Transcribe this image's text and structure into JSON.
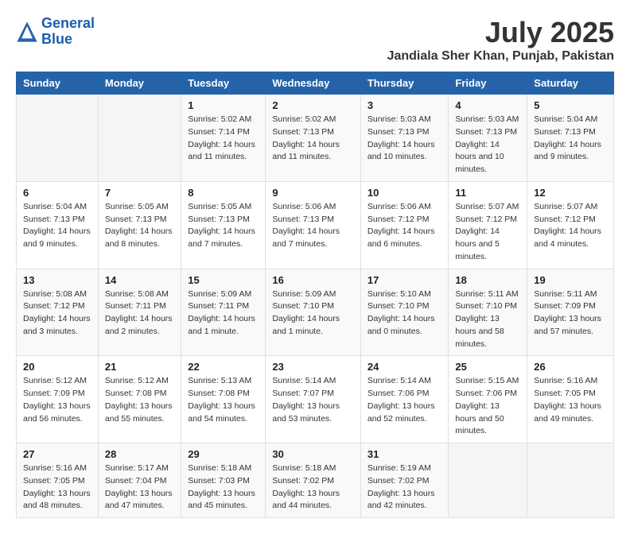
{
  "header": {
    "logo_line1": "General",
    "logo_line2": "Blue",
    "month": "July 2025",
    "location": "Jandiala Sher Khan, Punjab, Pakistan"
  },
  "days_of_week": [
    "Sunday",
    "Monday",
    "Tuesday",
    "Wednesday",
    "Thursday",
    "Friday",
    "Saturday"
  ],
  "weeks": [
    [
      {
        "day": "",
        "info": ""
      },
      {
        "day": "",
        "info": ""
      },
      {
        "day": "1",
        "info": "Sunrise: 5:02 AM\nSunset: 7:14 PM\nDaylight: 14 hours and 11 minutes."
      },
      {
        "day": "2",
        "info": "Sunrise: 5:02 AM\nSunset: 7:13 PM\nDaylight: 14 hours and 11 minutes."
      },
      {
        "day": "3",
        "info": "Sunrise: 5:03 AM\nSunset: 7:13 PM\nDaylight: 14 hours and 10 minutes."
      },
      {
        "day": "4",
        "info": "Sunrise: 5:03 AM\nSunset: 7:13 PM\nDaylight: 14 hours and 10 minutes."
      },
      {
        "day": "5",
        "info": "Sunrise: 5:04 AM\nSunset: 7:13 PM\nDaylight: 14 hours and 9 minutes."
      }
    ],
    [
      {
        "day": "6",
        "info": "Sunrise: 5:04 AM\nSunset: 7:13 PM\nDaylight: 14 hours and 9 minutes."
      },
      {
        "day": "7",
        "info": "Sunrise: 5:05 AM\nSunset: 7:13 PM\nDaylight: 14 hours and 8 minutes."
      },
      {
        "day": "8",
        "info": "Sunrise: 5:05 AM\nSunset: 7:13 PM\nDaylight: 14 hours and 7 minutes."
      },
      {
        "day": "9",
        "info": "Sunrise: 5:06 AM\nSunset: 7:13 PM\nDaylight: 14 hours and 7 minutes."
      },
      {
        "day": "10",
        "info": "Sunrise: 5:06 AM\nSunset: 7:12 PM\nDaylight: 14 hours and 6 minutes."
      },
      {
        "day": "11",
        "info": "Sunrise: 5:07 AM\nSunset: 7:12 PM\nDaylight: 14 hours and 5 minutes."
      },
      {
        "day": "12",
        "info": "Sunrise: 5:07 AM\nSunset: 7:12 PM\nDaylight: 14 hours and 4 minutes."
      }
    ],
    [
      {
        "day": "13",
        "info": "Sunrise: 5:08 AM\nSunset: 7:12 PM\nDaylight: 14 hours and 3 minutes."
      },
      {
        "day": "14",
        "info": "Sunrise: 5:08 AM\nSunset: 7:11 PM\nDaylight: 14 hours and 2 minutes."
      },
      {
        "day": "15",
        "info": "Sunrise: 5:09 AM\nSunset: 7:11 PM\nDaylight: 14 hours and 1 minute."
      },
      {
        "day": "16",
        "info": "Sunrise: 5:09 AM\nSunset: 7:10 PM\nDaylight: 14 hours and 1 minute."
      },
      {
        "day": "17",
        "info": "Sunrise: 5:10 AM\nSunset: 7:10 PM\nDaylight: 14 hours and 0 minutes."
      },
      {
        "day": "18",
        "info": "Sunrise: 5:11 AM\nSunset: 7:10 PM\nDaylight: 13 hours and 58 minutes."
      },
      {
        "day": "19",
        "info": "Sunrise: 5:11 AM\nSunset: 7:09 PM\nDaylight: 13 hours and 57 minutes."
      }
    ],
    [
      {
        "day": "20",
        "info": "Sunrise: 5:12 AM\nSunset: 7:09 PM\nDaylight: 13 hours and 56 minutes."
      },
      {
        "day": "21",
        "info": "Sunrise: 5:12 AM\nSunset: 7:08 PM\nDaylight: 13 hours and 55 minutes."
      },
      {
        "day": "22",
        "info": "Sunrise: 5:13 AM\nSunset: 7:08 PM\nDaylight: 13 hours and 54 minutes."
      },
      {
        "day": "23",
        "info": "Sunrise: 5:14 AM\nSunset: 7:07 PM\nDaylight: 13 hours and 53 minutes."
      },
      {
        "day": "24",
        "info": "Sunrise: 5:14 AM\nSunset: 7:06 PM\nDaylight: 13 hours and 52 minutes."
      },
      {
        "day": "25",
        "info": "Sunrise: 5:15 AM\nSunset: 7:06 PM\nDaylight: 13 hours and 50 minutes."
      },
      {
        "day": "26",
        "info": "Sunrise: 5:16 AM\nSunset: 7:05 PM\nDaylight: 13 hours and 49 minutes."
      }
    ],
    [
      {
        "day": "27",
        "info": "Sunrise: 5:16 AM\nSunset: 7:05 PM\nDaylight: 13 hours and 48 minutes."
      },
      {
        "day": "28",
        "info": "Sunrise: 5:17 AM\nSunset: 7:04 PM\nDaylight: 13 hours and 47 minutes."
      },
      {
        "day": "29",
        "info": "Sunrise: 5:18 AM\nSunset: 7:03 PM\nDaylight: 13 hours and 45 minutes."
      },
      {
        "day": "30",
        "info": "Sunrise: 5:18 AM\nSunset: 7:02 PM\nDaylight: 13 hours and 44 minutes."
      },
      {
        "day": "31",
        "info": "Sunrise: 5:19 AM\nSunset: 7:02 PM\nDaylight: 13 hours and 42 minutes."
      },
      {
        "day": "",
        "info": ""
      },
      {
        "day": "",
        "info": ""
      }
    ]
  ]
}
